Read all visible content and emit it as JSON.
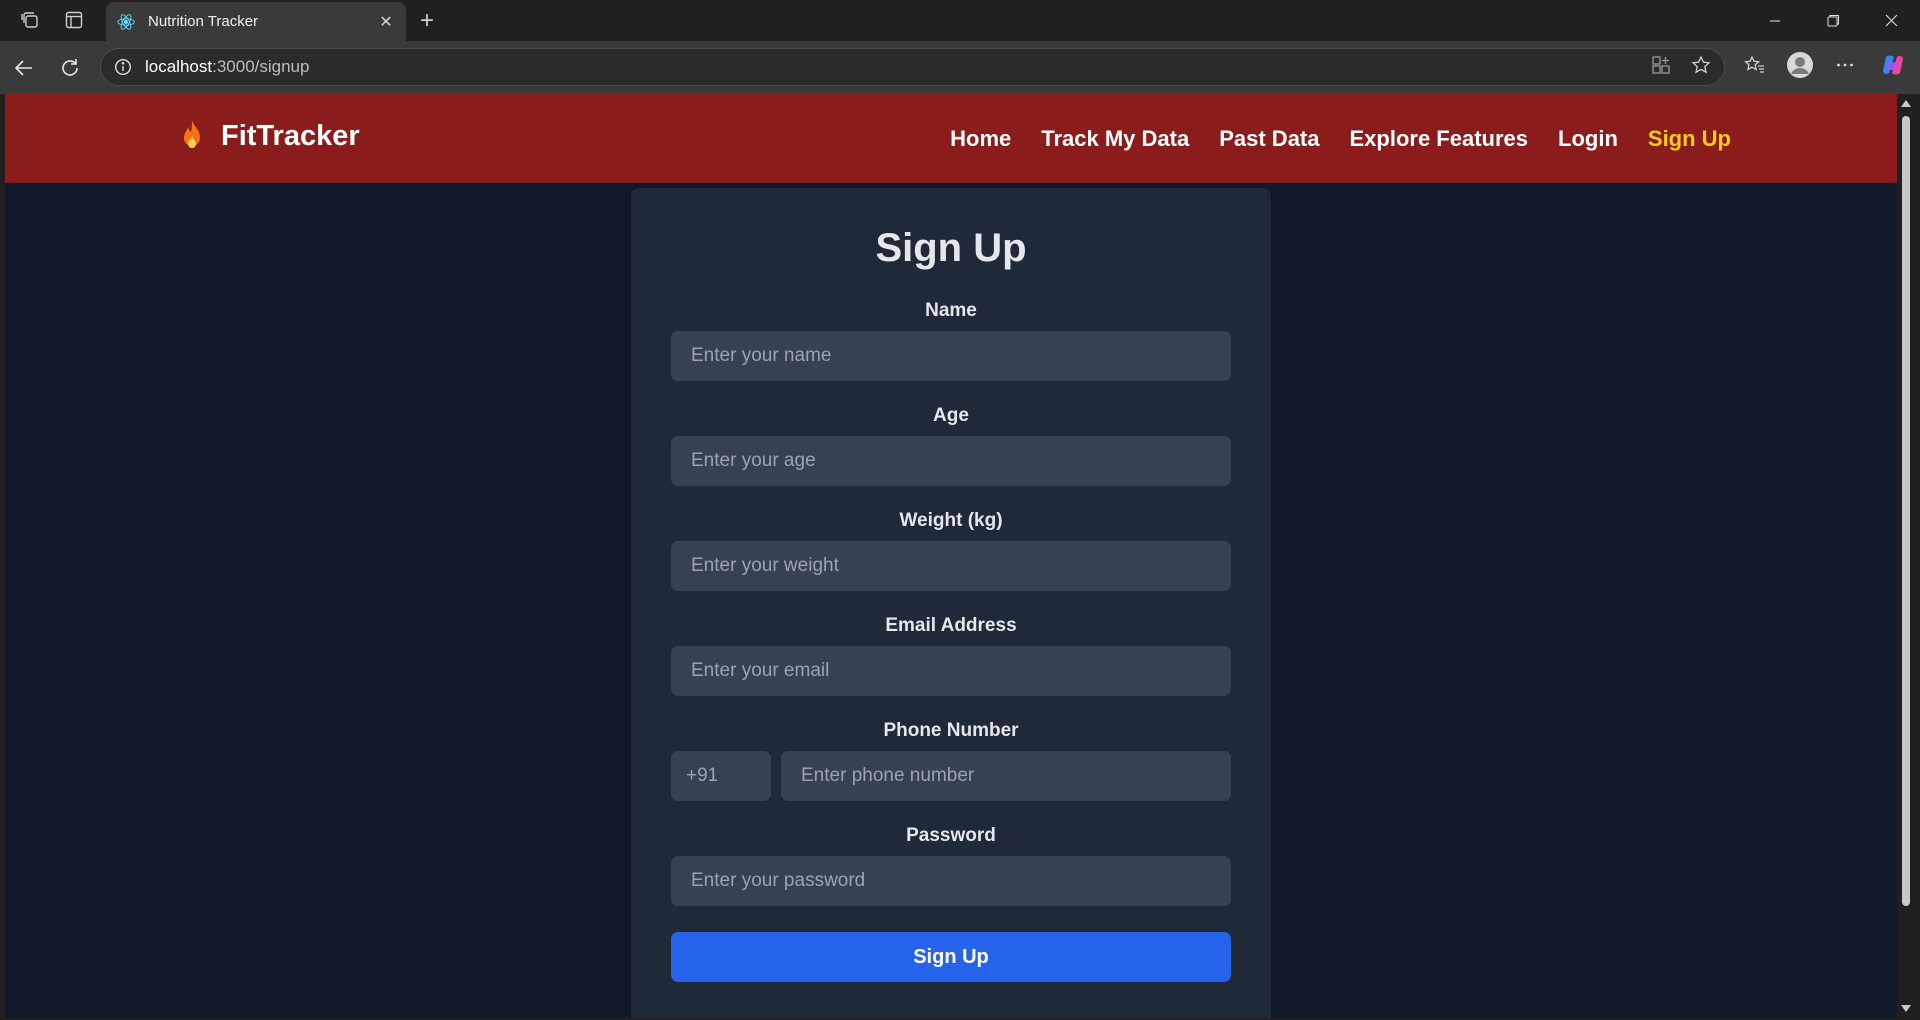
{
  "browser": {
    "tab_title": "Nutrition Tracker",
    "url_host": "localhost",
    "url_path": ":3000/signup"
  },
  "navbar": {
    "brand": "FitTracker",
    "links": [
      "Home",
      "Track My Data",
      "Past Data",
      "Explore Features",
      "Login",
      "Sign Up"
    ],
    "active_link": "Sign Up",
    "colors": {
      "background": "#8b1c1c",
      "active": "#facc15"
    }
  },
  "form": {
    "title": "Sign Up",
    "fields": {
      "name": {
        "label": "Name",
        "placeholder": "Enter your name"
      },
      "age": {
        "label": "Age",
        "placeholder": "Enter your age"
      },
      "weight": {
        "label": "Weight (kg)",
        "placeholder": "Enter your weight"
      },
      "email": {
        "label": "Email Address",
        "placeholder": "Enter your email"
      },
      "phone": {
        "label": "Phone Number",
        "country_code": "+91",
        "placeholder": "Enter phone number"
      },
      "password": {
        "label": "Password",
        "placeholder": "Enter your password"
      }
    },
    "submit_label": "Sign Up",
    "colors": {
      "page_bg": "#111827",
      "card_bg": "#1f2937",
      "input_bg": "#374151",
      "button": "#2563eb"
    }
  }
}
